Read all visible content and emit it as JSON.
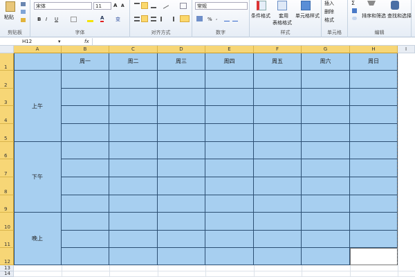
{
  "ribbon": {
    "clipboard": {
      "paste": "粘贴",
      "label": "剪贴板"
    },
    "font": {
      "name": "宋体",
      "size": "11",
      "label": "字体",
      "bold": "B",
      "italic": "I",
      "underline": "U",
      "grow": "A",
      "shrink": "A",
      "color": "A",
      "phonetic": "变"
    },
    "alignment": {
      "label": "对齐方式"
    },
    "number": {
      "format": "常规",
      "percent": "%",
      "comma": ",",
      "label": "数字"
    },
    "styles": {
      "conditional": "条件格式",
      "table_format_1": "套用",
      "table_format_2": "表格格式",
      "cell_styles": "单元格样式",
      "label": "样式"
    },
    "cells": {
      "insert": "插入",
      "delete": "删除",
      "format": "格式",
      "label": "单元格"
    },
    "editing": {
      "sum": "Σ",
      "sort": "排序和筛选",
      "find": "查找和选择",
      "label": "编辑"
    }
  },
  "formula_bar": {
    "name_box": "H12",
    "fx": "fx",
    "value": ""
  },
  "columns": [
    "A",
    "B",
    "C",
    "D",
    "E",
    "F",
    "G",
    "H",
    "I"
  ],
  "rows": [
    "1",
    "2",
    "3",
    "4",
    "5",
    "6",
    "7",
    "8",
    "9",
    "10",
    "11",
    "12",
    "13",
    "14"
  ],
  "table": {
    "days": [
      "周一",
      "周二",
      "周三",
      "周四",
      "周五",
      "周六",
      "周日"
    ],
    "periods": [
      "上午",
      "下午",
      "晚上"
    ]
  },
  "colors": {
    "fill": "#a7cff0",
    "header_selected": "#f7d676",
    "border": "#2c4f73"
  }
}
